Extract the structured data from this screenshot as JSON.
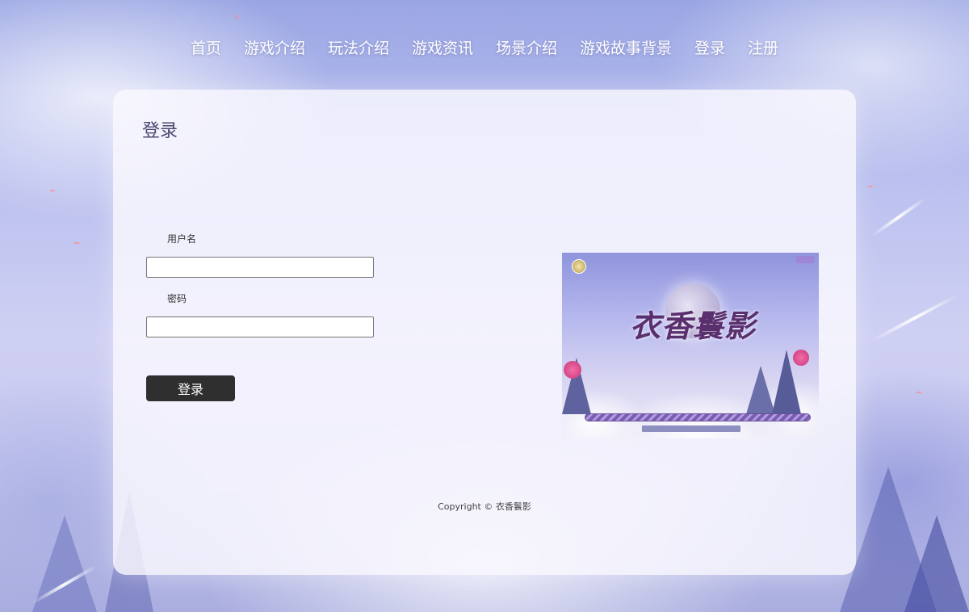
{
  "nav": {
    "items": [
      {
        "label": "首页"
      },
      {
        "label": "游戏介绍"
      },
      {
        "label": "玩法介绍"
      },
      {
        "label": "游戏资讯"
      },
      {
        "label": "场景介绍"
      },
      {
        "label": "游戏故事背景"
      },
      {
        "label": "登录"
      },
      {
        "label": "注册"
      }
    ]
  },
  "login": {
    "title": "登录",
    "username_label": "用户名",
    "username_value": "",
    "password_label": "密码",
    "password_value": "",
    "submit_label": "登录"
  },
  "promo": {
    "logo_text": "衣香鬟影"
  },
  "footer": {
    "copyright": "Copyright © 衣香鬟影"
  },
  "colors": {
    "button_bg": "#2f2f2f",
    "panel_bg": "#faf9ff",
    "title_text": "#4a4770"
  }
}
